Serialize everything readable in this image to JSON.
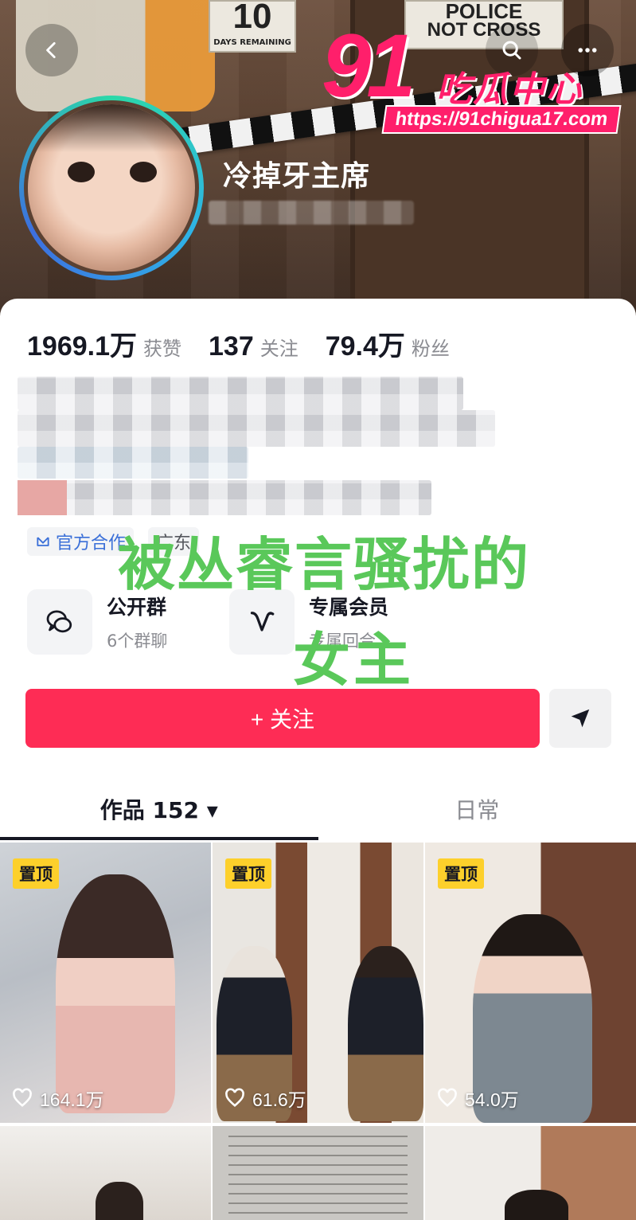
{
  "cover": {
    "days_sign_number": "10",
    "days_sign_label": "DAYS REMAINING",
    "police_sign_line1": "POLICE",
    "police_sign_line2": "NOT CROSS"
  },
  "watermark": {
    "number": "91",
    "name": "吃瓜中心",
    "url": "https://91chigua17.com"
  },
  "profile": {
    "nickname": "冷掉牙主席"
  },
  "stats": [
    {
      "value": "1969.1万",
      "label": "获赞"
    },
    {
      "value": "137",
      "label": "关注"
    },
    {
      "value": "79.4万",
      "label": "粉丝"
    }
  ],
  "tags": {
    "official": "官方合作",
    "location": "广东"
  },
  "features": [
    {
      "title": "公开群",
      "subtitle": "6个群聊",
      "icon": "chat-bubbles-icon"
    },
    {
      "title": "专属会员",
      "subtitle": "专属回合",
      "icon": "vip-v-icon"
    }
  ],
  "overlay": {
    "line1": "被丛睿言骚扰的",
    "line2": "女主"
  },
  "follow_button": "+ 关注",
  "tabs": [
    {
      "label": "作品 152 ▾",
      "active": true
    },
    {
      "label": "日常",
      "active": false
    }
  ],
  "videos": [
    {
      "pinned": true,
      "pin_label": "置顶",
      "likes": "164.1万"
    },
    {
      "pinned": true,
      "pin_label": "置顶",
      "likes": "61.6万"
    },
    {
      "pinned": true,
      "pin_label": "置顶",
      "likes": "54.0万"
    },
    {
      "pinned": false,
      "likes": ""
    },
    {
      "pinned": false,
      "likes": ""
    },
    {
      "pinned": false,
      "likes": ""
    }
  ],
  "colors": {
    "follow": "#fe2c55",
    "pin": "#fdd02b",
    "watermark": "#ff1f6b",
    "overlay_text": "#5ac85a"
  }
}
